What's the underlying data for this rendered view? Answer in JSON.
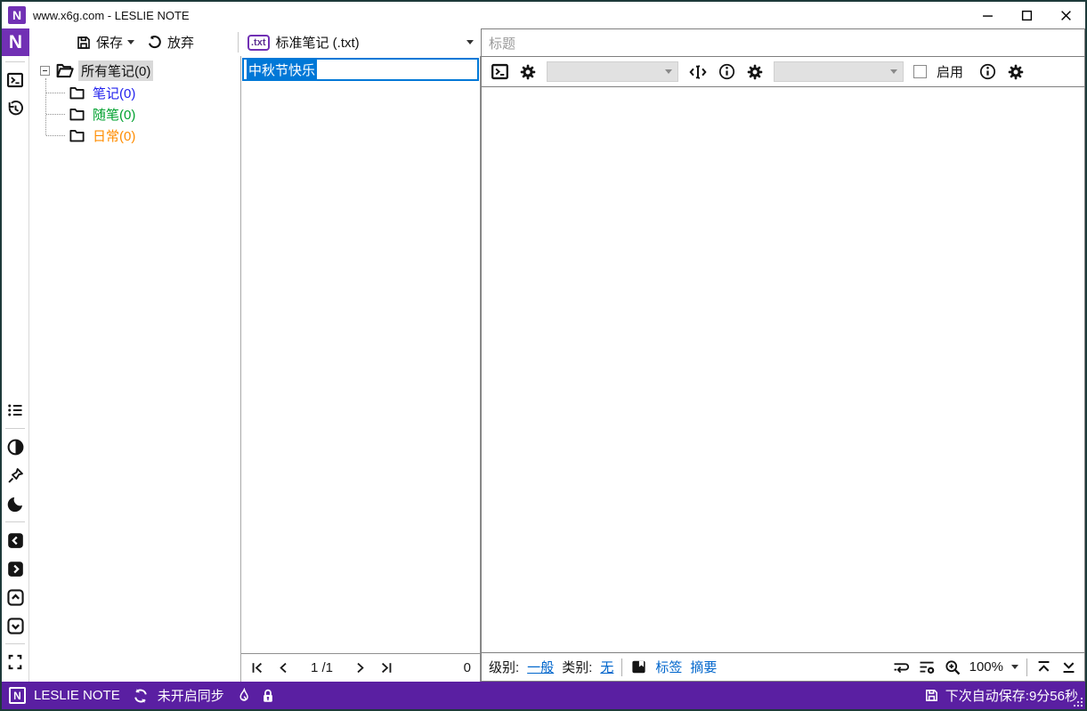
{
  "window": {
    "title": "www.x6g.com - LESLIE NOTE",
    "logo_letter": "N"
  },
  "toolbar": {
    "save": "保存",
    "discard": "放弃",
    "note_type_badge": ".txt",
    "note_type": "标准笔记 (.txt)"
  },
  "editor_header": {
    "title_placeholder": "标题",
    "enable_label": "启用"
  },
  "tree": {
    "items": [
      {
        "label": "所有笔记(0)",
        "color": "#141414",
        "selected": true,
        "expanded": true
      },
      {
        "label": "笔记(0)",
        "color": "#2222ee"
      },
      {
        "label": "随笔(0)",
        "color": "#00a12f"
      },
      {
        "label": "日常(0)",
        "color": "#ff8c00"
      }
    ]
  },
  "note_list": {
    "selected_title": "中秋节快乐",
    "page": "1",
    "page_total": "/1",
    "count": "0"
  },
  "editor_footer": {
    "level_label": "级别:",
    "level_value": "一般",
    "category_label": "类别:",
    "category_value": "无",
    "tags": "标签",
    "summary": "摘要",
    "zoom": "100%"
  },
  "status_bar": {
    "app_name": "LESLIE NOTE",
    "sync_status": "未开启同步",
    "autosave": "下次自动保存:9分56秒"
  },
  "colors": {
    "accent": "#7130b4",
    "accent_dark": "#5b2d90",
    "statusbar": "#5a1fa2",
    "selection": "#0078d7",
    "link": "#0066cc"
  },
  "icons": {
    "minimize": "—",
    "maximize": "▢",
    "close": "✕",
    "save": "floppy-disk",
    "save-more": "caret-down",
    "discard": "undo-arrow",
    "note-type-caret": "caret-down",
    "console": "terminal-box",
    "history": "clock-undo-arrow",
    "note-list": "bulleted-list",
    "contrast": "half-filled-circle",
    "pin": "pushpin",
    "dark-mode": "crescent-moon",
    "collapse-left": "boxed-chevron-left",
    "collapse-right": "boxed-chevron-right",
    "collapse-top": "boxed-chevron-up",
    "collapse-bottom": "boxed-chevron-down",
    "fullscreen": "corner-brackets",
    "text-cursor": "angle-i-beam",
    "info": "circled-i",
    "settings": "gear",
    "first-page": "bar-chevron-left",
    "prev-page": "chevron-left",
    "next-page": "chevron-right",
    "last-page": "chevron-right-bar",
    "bookmark": "bookmark-square",
    "word-wrap": "wrap-return-arrow",
    "list-settings": "list-gear",
    "zoom-in": "magnifier-plus",
    "scroll-top": "line-chevron-up",
    "scroll-bottom": "chevron-down-line",
    "sync": "circular-arrows",
    "flame": "flame-outline",
    "lock": "padlock",
    "autosave": "floppy-disk",
    "resize-grip": "diagonal-dots",
    "folder-open": "open-folder",
    "folder": "folder"
  }
}
